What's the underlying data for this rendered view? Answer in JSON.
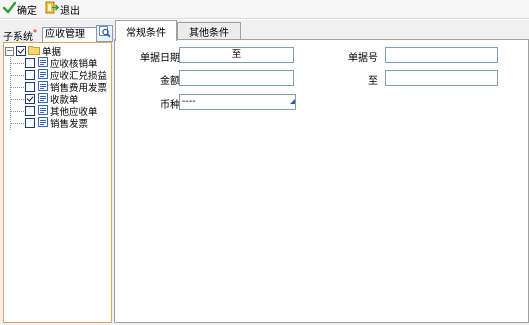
{
  "toolbar": {
    "confirm_label": "确定",
    "exit_label": "退出"
  },
  "subsystem": {
    "label": "子系统",
    "required_mark": "*",
    "value": "应收管理"
  },
  "tree": {
    "root": {
      "label": "单据",
      "checked": true,
      "expanded": true
    },
    "items": [
      {
        "label": "应收核销单",
        "checked": false
      },
      {
        "label": "应收汇兑损益",
        "checked": false
      },
      {
        "label": "销售费用发票",
        "checked": false
      },
      {
        "label": "收款单",
        "checked": true
      },
      {
        "label": "其他应收单",
        "checked": false
      },
      {
        "label": "销售发票",
        "checked": false
      }
    ]
  },
  "tabs": [
    {
      "label": "常规条件",
      "active": true
    },
    {
      "label": "其他条件",
      "active": false
    }
  ],
  "form": {
    "doc_date_label": "单据日期",
    "doc_date_to": "至",
    "doc_no_label": "单据号",
    "to_label": "至",
    "amount_label": "金额",
    "currency_label": "币种",
    "currency_value": "----"
  },
  "colors": {
    "tree_border": "#d9a85a",
    "input_border": "#7f9db9",
    "confirm_icon": "#2e9e2e",
    "exit_icon": "#e0a020"
  }
}
